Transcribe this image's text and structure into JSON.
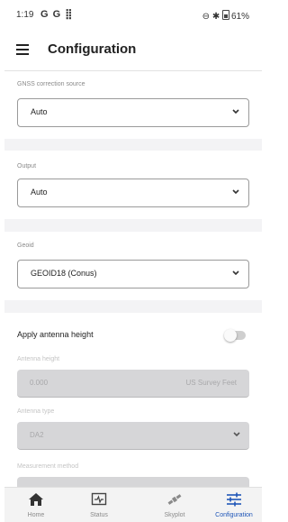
{
  "status_bar": {
    "time": "1:19",
    "left_icons": "G G ⣿",
    "right_icons": "⊖ ✱",
    "battery": "61%"
  },
  "app_bar": {
    "menu_icon": "hamburger-icon",
    "title": "Configuration"
  },
  "gnss_section": {
    "label": "GNSS correction source",
    "value": "Auto"
  },
  "output_section": {
    "label": "Output",
    "value": "Auto"
  },
  "geoid_section": {
    "label": "Geoid",
    "value": "GEOID18 (Conus)"
  },
  "antenna_section": {
    "apply_label": "Apply antenna height",
    "apply_enabled": false,
    "height_label": "Antenna height",
    "height_value": "0.000",
    "height_unit": "US Survey Feet",
    "type_label": "Antenna type",
    "type_value": "DA2",
    "method_label": "Measurement method"
  },
  "bottom_nav": {
    "items": [
      {
        "label": "Home",
        "icon": "home-icon",
        "active": false
      },
      {
        "label": "Status",
        "icon": "status-icon",
        "active": false
      },
      {
        "label": "Skyplot",
        "icon": "skyplot-icon",
        "active": false
      },
      {
        "label": "Configuration",
        "icon": "configuration-icon",
        "active": true
      }
    ]
  },
  "colors": {
    "accent": "#1f56b8",
    "background": "#f3f3f5",
    "disabled_field": "#d6d6d8"
  }
}
